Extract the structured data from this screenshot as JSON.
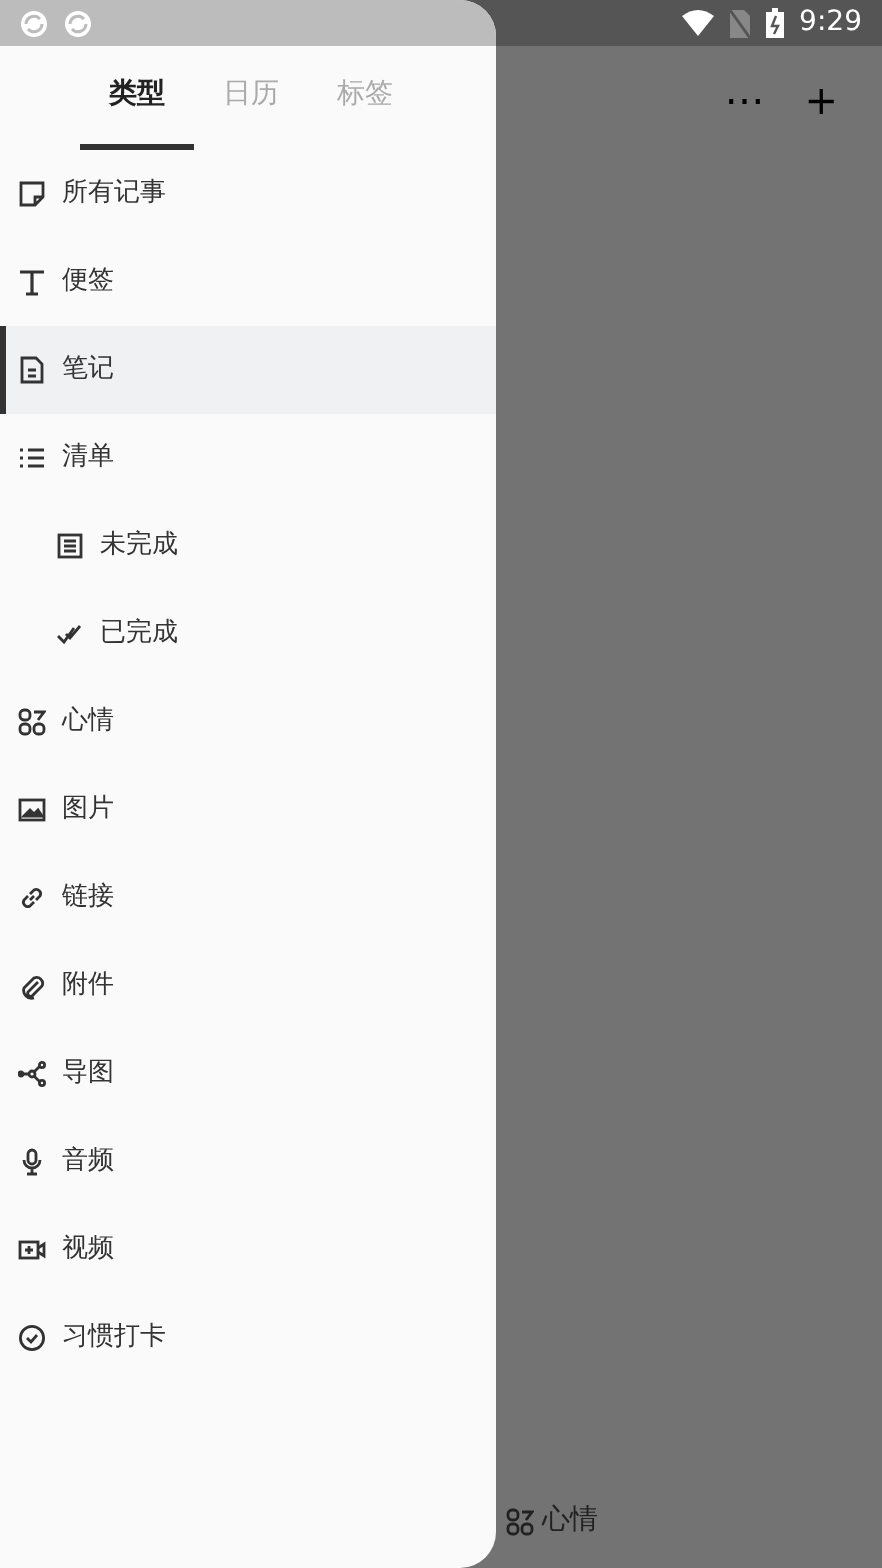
{
  "status_bar": {
    "time": "9:29"
  },
  "background": {
    "toolbar": [
      "⋯",
      "+"
    ],
    "bottom_item": {
      "label": "心情"
    }
  },
  "drawer": {
    "tabs": [
      {
        "label": "类型",
        "selected": true
      },
      {
        "label": "日历",
        "selected": false
      },
      {
        "label": "标签",
        "selected": false
      }
    ],
    "items": [
      {
        "label": "所有记事",
        "selected": false
      },
      {
        "label": "便签",
        "selected": false
      },
      {
        "label": "笔记",
        "selected": true
      },
      {
        "label": "清单",
        "selected": false,
        "children": [
          {
            "label": "未完成",
            "selected": false
          },
          {
            "label": "已完成",
            "selected": false
          }
        ]
      },
      {
        "label": "心情",
        "selected": false
      },
      {
        "label": "图片",
        "selected": false
      },
      {
        "label": "链接",
        "selected": false
      },
      {
        "label": "附件",
        "selected": false
      },
      {
        "label": "导图",
        "selected": false
      },
      {
        "label": "音频",
        "selected": false
      },
      {
        "label": "视频",
        "selected": false
      },
      {
        "label": "习惯打卡",
        "selected": false
      }
    ]
  }
}
